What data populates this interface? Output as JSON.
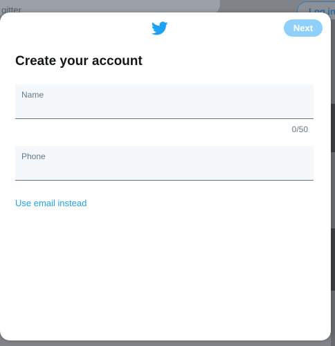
{
  "background": {
    "search_text": "gitter",
    "login_label": "Log in"
  },
  "modal": {
    "logo_icon": "twitter-bird-icon",
    "next_label": "Next",
    "title": "Create your account",
    "name_field": {
      "label": "Name",
      "value": "",
      "counter": "0/50"
    },
    "phone_field": {
      "label": "Phone",
      "value": ""
    },
    "use_email_link": "Use email instead"
  },
  "colors": {
    "brand": "#1da1f2",
    "next_disabled": "#8ed0f9"
  }
}
